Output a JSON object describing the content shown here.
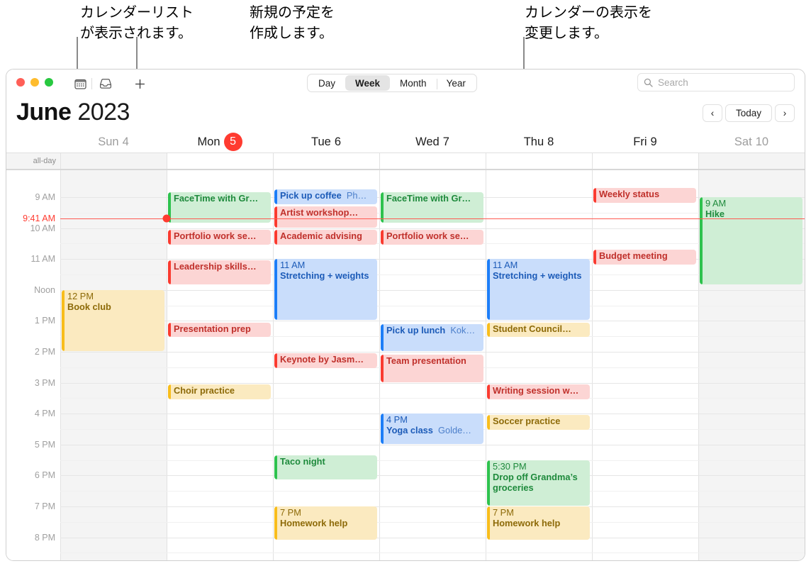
{
  "callouts": [
    {
      "text": "カレンダーリスト\nが表示されます。"
    },
    {
      "text": "新規の予定を\n作成します。"
    },
    {
      "text": "カレンダーの表示を\n変更します。"
    }
  ],
  "toolbar": {
    "calendar_icon": "calendar-icon",
    "inbox_icon": "inbox-icon",
    "add_label": "+",
    "views": [
      {
        "label": "Day",
        "active": false
      },
      {
        "label": "Week",
        "active": true
      },
      {
        "label": "Month",
        "active": false
      },
      {
        "label": "Year",
        "active": false
      }
    ],
    "search_placeholder": "Search",
    "search_value": "",
    "search_icon": "search-icon"
  },
  "header": {
    "month": "June",
    "year": "2023",
    "prev_label": "‹",
    "today_label": "Today",
    "next_label": "›"
  },
  "days": [
    {
      "name": "Sun",
      "num": "4",
      "weekend": true,
      "today": false
    },
    {
      "name": "Mon",
      "num": "5",
      "weekend": false,
      "today": true
    },
    {
      "name": "Tue",
      "num": "6",
      "weekend": false,
      "today": false
    },
    {
      "name": "Wed",
      "num": "7",
      "weekend": false,
      "today": false
    },
    {
      "name": "Thu",
      "num": "8",
      "weekend": false,
      "today": false
    },
    {
      "name": "Fri",
      "num": "9",
      "weekend": false,
      "today": false
    },
    {
      "name": "Sat",
      "num": "10",
      "weekend": true,
      "today": false
    }
  ],
  "allday_label": "all-day",
  "time_labels": [
    "9 AM",
    "10 AM",
    "11 AM",
    "Noon",
    "1 PM",
    "2 PM",
    "3 PM",
    "4 PM",
    "5 PM",
    "6 PM",
    "7 PM",
    "8 PM"
  ],
  "now": {
    "label": "9:41 AM",
    "day_index": 1
  },
  "events": [
    {
      "day": 0,
      "start": 12.0,
      "end": 14.0,
      "time": "12 PM",
      "title": "Book club",
      "loc": "",
      "color": "yellow",
      "layout": "stacked"
    },
    {
      "day": 1,
      "start": 8.85,
      "end": 9.85,
      "time": "",
      "title": "FaceTime with Gr…",
      "loc": "",
      "color": "green",
      "layout": "inline"
    },
    {
      "day": 1,
      "start": 10.05,
      "end": 10.55,
      "time": "",
      "title": "Portfolio work se…",
      "loc": "",
      "color": "red",
      "layout": "inline"
    },
    {
      "day": 1,
      "start": 11.05,
      "end": 11.85,
      "time": "",
      "title": "Leadership skills…",
      "loc": "",
      "color": "red",
      "layout": "inline"
    },
    {
      "day": 1,
      "start": 13.05,
      "end": 13.55,
      "time": "",
      "title": "Presentation prep",
      "loc": "",
      "color": "red",
      "layout": "inline"
    },
    {
      "day": 1,
      "start": 15.05,
      "end": 15.55,
      "time": "",
      "title": "Choir practice",
      "loc": "",
      "color": "yellow",
      "layout": "inline"
    },
    {
      "day": 2,
      "start": 8.75,
      "end": 9.25,
      "time": "",
      "title": "Pick up coffee",
      "loc": "Ph…",
      "color": "blue",
      "layout": "inline"
    },
    {
      "day": 2,
      "start": 9.3,
      "end": 10.0,
      "time": "",
      "title": "Artist workshop…",
      "loc": "",
      "color": "red",
      "layout": "inline"
    },
    {
      "day": 2,
      "start": 10.05,
      "end": 10.55,
      "time": "",
      "title": "Academic advising",
      "loc": "",
      "color": "red",
      "layout": "inline"
    },
    {
      "day": 2,
      "start": 11.0,
      "end": 13.0,
      "time": "11 AM",
      "title": "Stretching + weights",
      "loc": "",
      "color": "blue",
      "layout": "stacked"
    },
    {
      "day": 2,
      "start": 14.05,
      "end": 14.55,
      "time": "",
      "title": "Keynote by Jasm…",
      "loc": "",
      "color": "red",
      "layout": "inline"
    },
    {
      "day": 2,
      "start": 17.35,
      "end": 18.15,
      "time": "",
      "title": "Taco night",
      "loc": "",
      "color": "green",
      "layout": "inline"
    },
    {
      "day": 2,
      "start": 19.0,
      "end": 20.1,
      "time": "7 PM",
      "title": "Homework help",
      "loc": "",
      "color": "yellow",
      "layout": "stacked"
    },
    {
      "day": 3,
      "start": 8.85,
      "end": 9.85,
      "time": "",
      "title": "FaceTime with Gr…",
      "loc": "",
      "color": "green",
      "layout": "inline"
    },
    {
      "day": 3,
      "start": 10.05,
      "end": 10.55,
      "time": "",
      "title": "Portfolio work se…",
      "loc": "",
      "color": "red",
      "layout": "inline"
    },
    {
      "day": 3,
      "start": 13.1,
      "end": 14.0,
      "time": "",
      "title": "Pick up lunch",
      "loc": "Kok…",
      "color": "blue",
      "layout": "inline"
    },
    {
      "day": 3,
      "start": 14.1,
      "end": 15.0,
      "time": "",
      "title": "Team presentation",
      "loc": "",
      "color": "red",
      "layout": "inline"
    },
    {
      "day": 3,
      "start": 16.0,
      "end": 17.0,
      "time": "4 PM",
      "title": "Yoga class",
      "loc": "Golde…",
      "color": "blue",
      "layout": "stacked-inline"
    },
    {
      "day": 4,
      "start": 11.0,
      "end": 13.0,
      "time": "11 AM",
      "title": "Stretching + weights",
      "loc": "",
      "color": "blue",
      "layout": "stacked"
    },
    {
      "day": 4,
      "start": 13.05,
      "end": 13.55,
      "time": "",
      "title": "Student Council…",
      "loc": "",
      "color": "yellow",
      "layout": "inline"
    },
    {
      "day": 4,
      "start": 15.05,
      "end": 15.55,
      "time": "",
      "title": "Writing session w…",
      "loc": "",
      "color": "red",
      "layout": "inline"
    },
    {
      "day": 4,
      "start": 16.05,
      "end": 16.55,
      "time": "",
      "title": "Soccer practice",
      "loc": "",
      "color": "yellow",
      "layout": "inline"
    },
    {
      "day": 4,
      "start": 17.5,
      "end": 19.0,
      "time": "5:30 PM",
      "title": "Drop off Grandma’s groceries",
      "loc": "",
      "color": "green",
      "layout": "stacked"
    },
    {
      "day": 4,
      "start": 19.0,
      "end": 20.1,
      "time": "7 PM",
      "title": "Homework help",
      "loc": "",
      "color": "yellow",
      "layout": "stacked"
    },
    {
      "day": 5,
      "start": 8.7,
      "end": 9.2,
      "time": "",
      "title": "Weekly status",
      "loc": "",
      "color": "red",
      "layout": "inline"
    },
    {
      "day": 5,
      "start": 10.7,
      "end": 11.2,
      "time": "",
      "title": "Budget meeting",
      "loc": "",
      "color": "red",
      "layout": "inline"
    },
    {
      "day": 6,
      "start": 9.0,
      "end": 11.85,
      "time": "9 AM",
      "title": "Hike",
      "loc": "",
      "color": "green",
      "layout": "stacked"
    }
  ]
}
